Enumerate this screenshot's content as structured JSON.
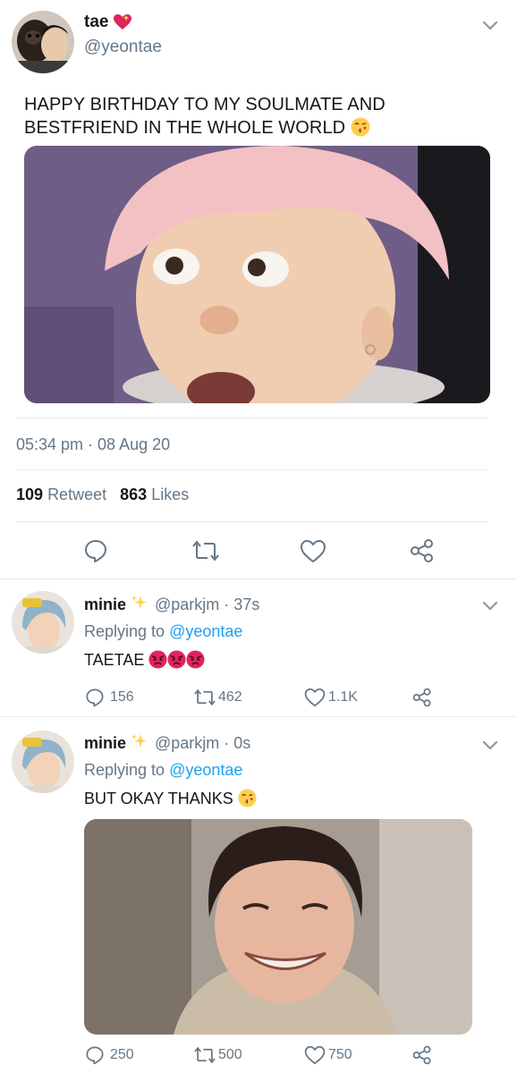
{
  "main_tweet": {
    "display_name": "tae",
    "handle": "@yeontae",
    "text": "HAPPY BIRTHDAY TO MY SOULMATE AND BESTFRIEND IN THE WHOLE WORLD",
    "timestamp": "05:34 pm · 08 Aug 20",
    "retweets": "109",
    "retweets_label": "Retweet",
    "likes": "863",
    "likes_label": "Likes",
    "icons": [
      "sparkling-heart-emoji",
      "kissing-face-emoji",
      "chevron-down-icon",
      "reply-icon",
      "retweet-icon",
      "heart-icon",
      "share-icon"
    ]
  },
  "replies": [
    {
      "display_name": "minie",
      "handle": "@parkjm · 37s",
      "replying_prefix": "Replying to",
      "replying_to": "@yeontae",
      "text": "TAETAE",
      "reply_count": "156",
      "retweet_count": "462",
      "like_count": "1.1K",
      "emojis": [
        "angry-face-emoji",
        "angry-face-emoji",
        "angry-face-emoji"
      ]
    },
    {
      "display_name": "minie",
      "handle": "@parkjm · 0s",
      "replying_prefix": "Replying to",
      "replying_to": "@yeontae",
      "text": "BUT OKAY THANKS",
      "reply_count": "250",
      "retweet_count": "500",
      "like_count": "750",
      "emojis": [
        "kissing-face-emoji"
      ]
    }
  ],
  "colors": {
    "text": "#14171a",
    "secondary": "#657786",
    "link": "#1da1f2",
    "divider": "#e6ecf0"
  }
}
